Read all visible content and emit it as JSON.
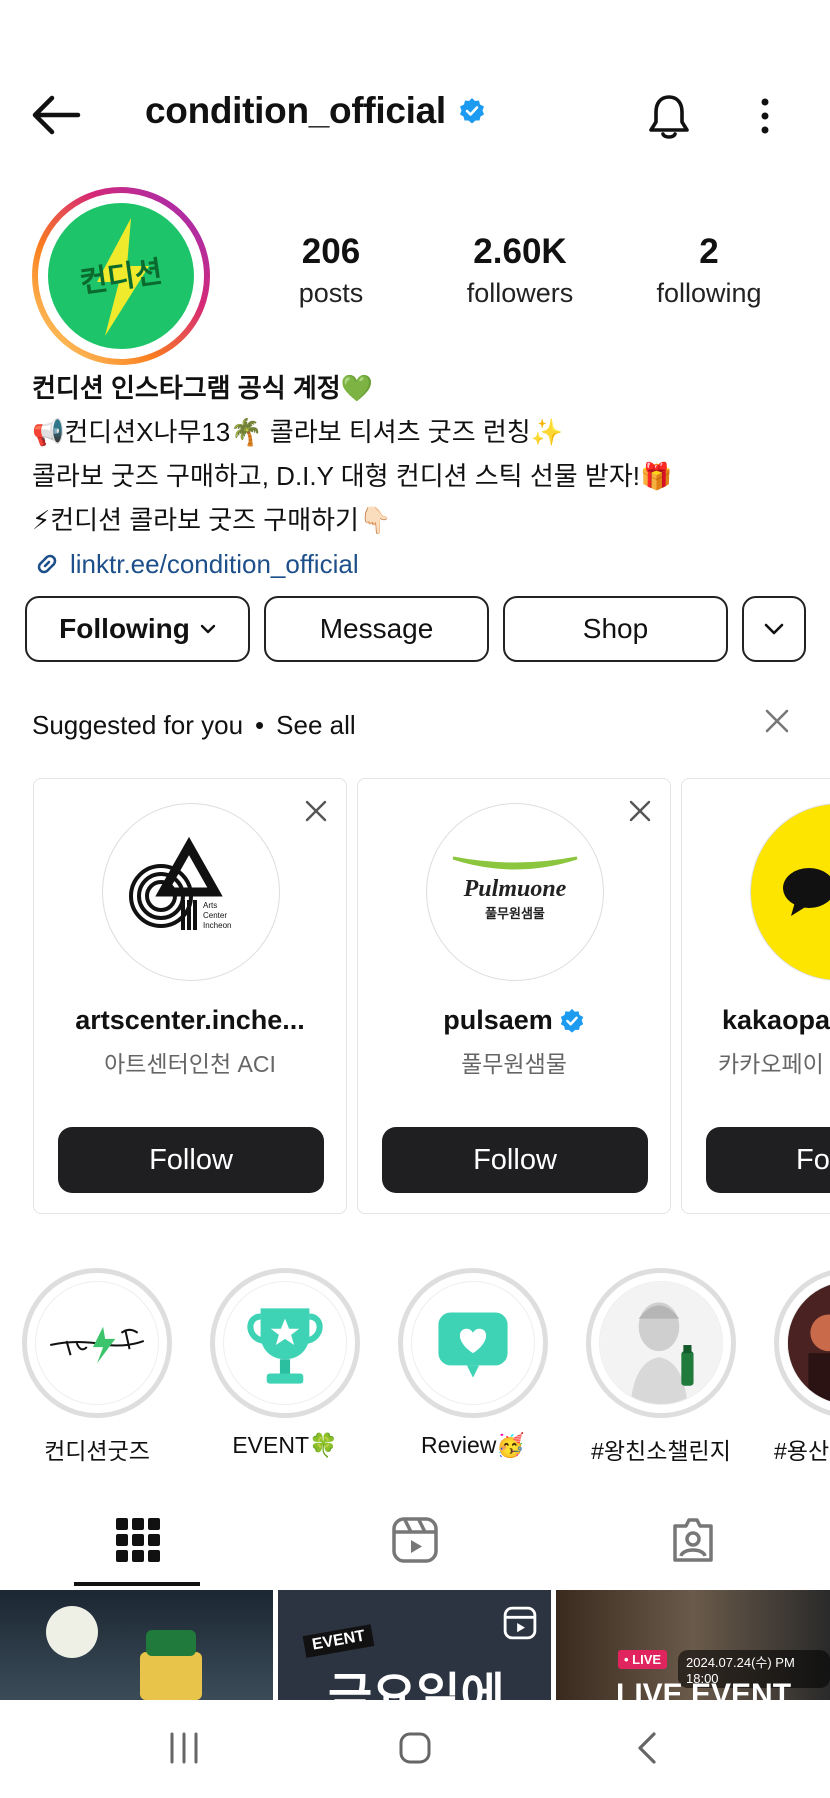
{
  "header": {
    "username": "condition_official",
    "icons": [
      "back-arrow-icon",
      "verified-badge-icon",
      "bell-icon",
      "more-vert-icon"
    ]
  },
  "profile": {
    "avatar_text": "컨디션",
    "stats": [
      {
        "value": "206",
        "label": "posts"
      },
      {
        "value": "2.60K",
        "label": "followers"
      },
      {
        "value": "2",
        "label": "following"
      }
    ]
  },
  "bio": {
    "name": "컨디션 인스타그램 공식 계정💚",
    "lines": [
      "📢컨디션X나무13🌴 콜라보 티셔츠 굿즈 런칭✨",
      "콜라보 굿즈 구매하고, D.I.Y 대형 컨디션 스틱 선물 받자!🎁",
      "⚡컨디션 콜라보 굿즈 구매하기👇🏻"
    ],
    "link": "linktr.ee/condition_official"
  },
  "actions": {
    "following": "Following",
    "message": "Message",
    "shop": "Shop"
  },
  "suggested": {
    "title": "Suggested for you",
    "see_all": "See all",
    "cards": [
      {
        "username": "artscenter.inche...",
        "subtitle": "아트센터인천 ACI",
        "follow": "Follow",
        "logo_text": [
          "Arts",
          "Center",
          "Incheon"
        ]
      },
      {
        "username": "pulsaem",
        "subtitle": "풀무원샘물",
        "follow": "Follow",
        "logo_text": [
          "Pulmuone",
          "풀무원샘물"
        ]
      },
      {
        "username": "kakaopa",
        "subtitle": "카카오페이",
        "follow": "Fo"
      }
    ]
  },
  "highlights": [
    {
      "label": "컨디션굿즈"
    },
    {
      "label": "EVENT🍀"
    },
    {
      "label": "Review🥳"
    },
    {
      "label": "#왕친소챌린지"
    },
    {
      "label": "#용산"
    }
  ],
  "grid": {
    "tiles": [
      {
        "caption": ""
      },
      {
        "badge": "EVENT",
        "caption": "금요일에"
      },
      {
        "badge": "• LIVE",
        "date": "2024.07.24(수) PM 18:00",
        "caption": "LIVE EVENT"
      }
    ]
  },
  "colors": {
    "verified": "#1d9bf0",
    "follow_bg": "#1f1f22",
    "brand_green": "#1db954",
    "brand_yellow": "#f5e400"
  }
}
